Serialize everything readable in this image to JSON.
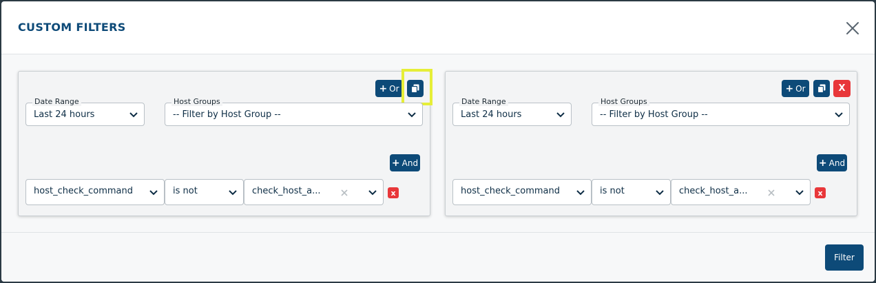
{
  "modal": {
    "title": "CUSTOM FILTERS",
    "footer": {
      "filter_label": "Filter"
    }
  },
  "panels": [
    {
      "or_label": "Or",
      "and_label": "And",
      "date_range": {
        "label": "Date Range",
        "value": "Last 24 hours"
      },
      "host_groups": {
        "label": "Host Groups",
        "value": "-- Filter by Host Group --"
      },
      "condition": {
        "field": "host_check_command",
        "operator": "is not",
        "value": "check_host_a..."
      },
      "delete_label": "x"
    },
    {
      "or_label": "Or",
      "and_label": "And",
      "date_range": {
        "label": "Date Range",
        "value": "Last 24 hours"
      },
      "host_groups": {
        "label": "Host Groups",
        "value": "-- Filter by Host Group --"
      },
      "condition": {
        "field": "host_check_command",
        "operator": "is not",
        "value": "check_host_a..."
      },
      "delete_panel_label": "X",
      "delete_label": "x"
    }
  ],
  "colors": {
    "primary": "#0d4a78",
    "danger": "#e8373a",
    "highlight": "#e6ee38"
  }
}
